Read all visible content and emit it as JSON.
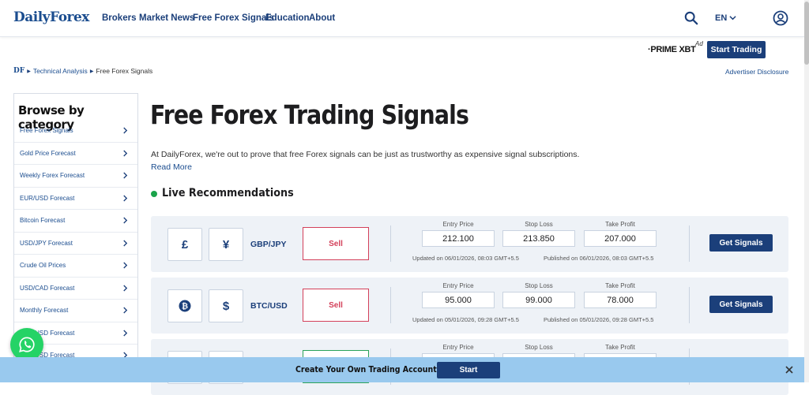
{
  "header": {
    "logo": "DailyForex",
    "nav": [
      "Brokers",
      "Market News",
      "Free Forex Signals",
      "Education",
      "About"
    ],
    "language": "EN",
    "icons": {
      "search": "search-icon",
      "lang_dropdown": "chevron-down-icon",
      "account": "user-icon"
    }
  },
  "ad": {
    "brand": "·PRIME XBT",
    "tag": "Ad",
    "cta": "Start Trading"
  },
  "breadcrumb": {
    "root": "DF",
    "items": [
      "Technical Analysis",
      "Free Forex Signals"
    ],
    "advertiser_disclosure": "Advertiser Disclosure"
  },
  "sidebar": {
    "title": "Browse by category",
    "items": [
      {
        "label": "Free Forex Signals"
      },
      {
        "label": "Gold Price Forecast"
      },
      {
        "label": "Weekly Forex Forecast"
      },
      {
        "label": "EUR/USD Forecast"
      },
      {
        "label": "Bitcoin Forecast"
      },
      {
        "label": "USD/JPY Forecast"
      },
      {
        "label": "Crude Oil Prices"
      },
      {
        "label": "USD/CAD Forecast"
      },
      {
        "label": "Monthly Forecast"
      },
      {
        "label": "GBP/USD Forecast"
      },
      {
        "label": "AUD/USD Forecast"
      }
    ]
  },
  "main": {
    "title": "Free Forex Trading Signals",
    "intro": "At DailyForex, we're out to prove that free Forex signals can be just as trustworthy as expensive signal subscriptions.",
    "read_more": "Read More",
    "live_title": "Live Recommendations",
    "labels": {
      "entry": "Entry Price",
      "stop": "Stop Loss",
      "take": "Take Profit"
    },
    "get_signals": "Get Signals",
    "signals": [
      {
        "icon1": "£",
        "icon2": "¥",
        "pair": "GBP/JPY",
        "action": "Sell",
        "entry": "212.100",
        "stop": "213.850",
        "take": "207.000",
        "updated": "Updated on 06/01/2026, 08:03 GMT+5.5",
        "published": "Published on 06/01/2026, 08:03 GMT+5.5"
      },
      {
        "icon1": "₿",
        "icon2": "$",
        "pair": "BTC/USD",
        "action": "Sell",
        "entry": "95.000",
        "stop": "99.000",
        "take": "78.000",
        "updated": "Updated on 05/01/2026, 09:28 GMT+5.5",
        "published": "Published on 05/01/2026, 09:28 GMT+5.5"
      }
    ]
  },
  "bottom_banner": {
    "text": "Create Your Own Trading Account",
    "cta": "Start"
  },
  "colors": {
    "brand_blue": "#1b3f7a",
    "sell_red": "#d3405a",
    "buy_green": "#2aa35a",
    "card_bg": "#eef2f7",
    "banner_bg": "#99c9ee",
    "whatsapp": "#25d366"
  }
}
